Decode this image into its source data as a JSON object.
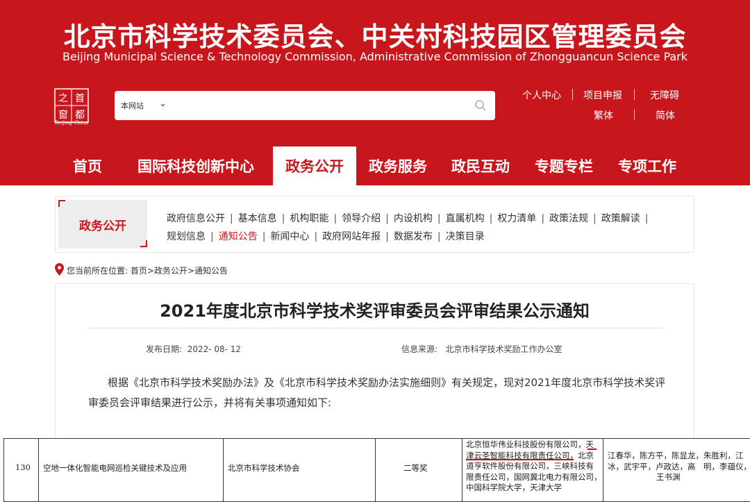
{
  "header": {
    "title_cn": "北京市科学技术委员会、中关村科技园区管理委员会",
    "title_en": "Beijing Municipal Science & Technology Commission, Administrative Commission of Zhongguancun Science Park",
    "logo_text": "首都之窗",
    "logo_sub": "Beijing-China",
    "colors": {
      "brand_red": "#c8161d"
    }
  },
  "search": {
    "scope": "本网站",
    "chevron_icon": "chevron-down-icon",
    "icon": "search-icon",
    "query": ""
  },
  "toplinks": {
    "personal": "个人中心",
    "project": "项目申报",
    "accessible": "无障碍",
    "traditional": "繁体",
    "simplified": "简体"
  },
  "nav": {
    "items": [
      {
        "label": "首页"
      },
      {
        "label": "国际科技创新中心"
      },
      {
        "label": "政务公开",
        "active": true
      },
      {
        "label": "政务服务"
      },
      {
        "label": "政民互动"
      },
      {
        "label": "专题专栏"
      },
      {
        "label": "专项工作"
      }
    ]
  },
  "submenu": {
    "section_label": "政务公开",
    "row1": [
      "政府信息公开",
      "基本信息",
      "机构职能",
      "领导介绍",
      "内设机构",
      "直属机构",
      "权力清单",
      "政策法规",
      "政策解读"
    ],
    "row2": [
      "规划信息",
      "通知公告",
      "新闻中心",
      "政府网站年报",
      "数据发布",
      "决策目录"
    ],
    "active": "通知公告"
  },
  "breadcrumb": {
    "prefix": "您当前所在位置:",
    "path": "首页>政务公开>通知公告"
  },
  "article": {
    "title": "2021年度北京市科学技术奖评审委员会评审结果公示通知",
    "date_label": "发布日期:",
    "date": "2022- 08- 12",
    "source_label": "信息来源:",
    "source": "北京市科学技术奖励工作办公室",
    "para_line1": "根据《北京市科学技术奖励办法》及《北京市科学技术奖励办法实施细则》有关规定，现对2021年度北京市科学技术奖评",
    "para_line2": "审委员会评审结果进行公示，并将有关事项通知如下:"
  },
  "table_row": {
    "no": "130",
    "project": "空地一体化智能电网巡检关键技术及应用",
    "nominator": "北京市科学技术协会",
    "award": "二等奖",
    "units_lines": [
      "北京恒华伟业科技股份有限公司，天",
      "津云圣智能科技有限责任公司，北京",
      "道亨软件股份有限公司，三峡科技有",
      "限责任公司，国网冀北电力有限公司，",
      "中国科学院大学，天津大学"
    ],
    "people_lines": [
      "江春华，陈方平，陈显龙，朱胜利，江",
      "冰，武宇平，卢政达，高　明，李蕴仪，",
      "王书渊"
    ]
  }
}
